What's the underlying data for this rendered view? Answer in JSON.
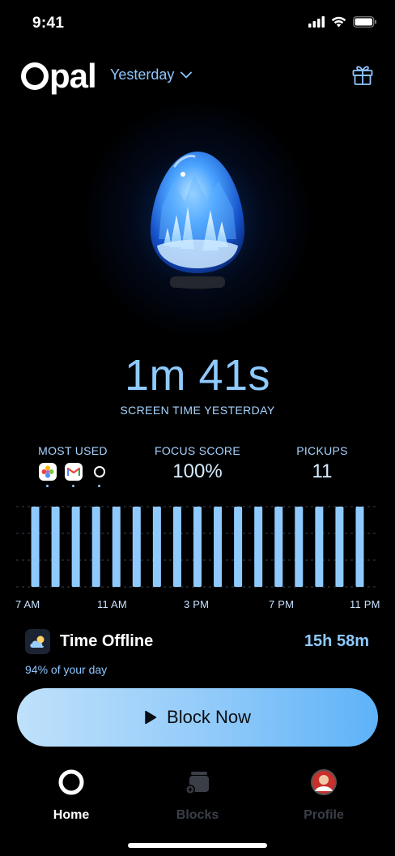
{
  "status_bar": {
    "time": "9:41"
  },
  "header": {
    "app_name": "pal",
    "period": "Yesterday"
  },
  "screen_time": {
    "value": "1m 41s",
    "caption": "SCREEN TIME YESTERDAY"
  },
  "stats": {
    "most_used_label": "MOST USED",
    "most_used_apps": [
      "photos-icon",
      "gmail-icon",
      "opal-icon"
    ],
    "focus_label": "FOCUS SCORE",
    "focus_value": "100%",
    "pickups_label": "PICKUPS",
    "pickups_value": "11"
  },
  "chart_data": {
    "type": "bar",
    "bar_count": 17,
    "values": [
      1,
      1,
      1,
      1,
      1,
      1,
      1,
      1,
      1,
      1,
      1,
      1,
      1,
      1,
      1,
      1,
      1
    ],
    "tick_labels": [
      "7 AM",
      "11 AM",
      "3 PM",
      "7 PM",
      "11 PM"
    ],
    "bar_color": "#8fcaff",
    "grid": true
  },
  "offline": {
    "label": "Time Offline",
    "value": "15h 58m",
    "percent_text": "94% of your day"
  },
  "block_button": {
    "label": "Block Now"
  },
  "tabs": [
    {
      "label": "Home",
      "icon": "home-ring-icon",
      "active": true
    },
    {
      "label": "Blocks",
      "icon": "blocks-icon",
      "active": false
    },
    {
      "label": "Profile",
      "icon": "avatar-icon",
      "active": false
    }
  ],
  "colors": {
    "accent": "#8fcaff",
    "inactive_tab": "#3a3f47",
    "background": "#000000"
  }
}
